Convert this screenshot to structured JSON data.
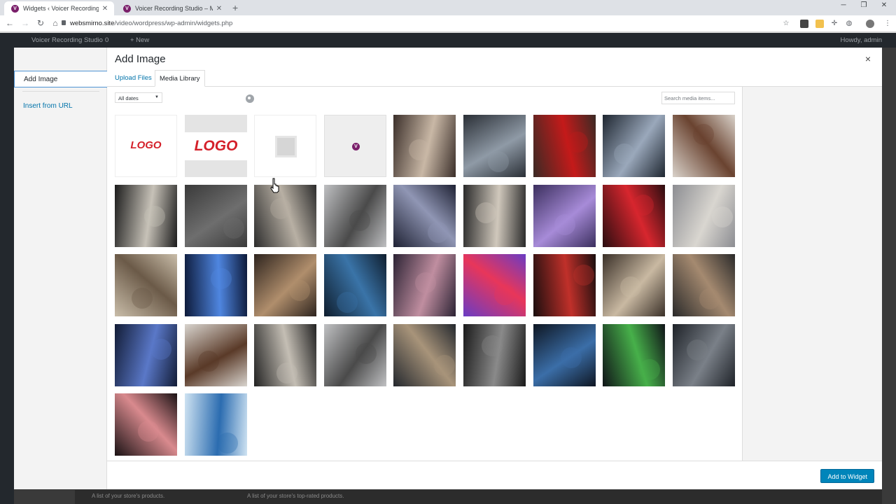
{
  "browser": {
    "tabs": [
      {
        "title": "Widgets ‹ Voicer Recording Studio",
        "active": true
      },
      {
        "title": "Voicer Recording Studio – Music",
        "active": false
      }
    ],
    "url_host": "websmirno.site",
    "url_path": "/video/wordpress/wp-admin/widgets.php"
  },
  "admin_bar": {
    "site_name": "Voicer Recording Studio",
    "comments_count": "0",
    "new_label": "+ New",
    "howdy": "Howdy, admin"
  },
  "footer": {
    "text_left": "A list of your store's products.",
    "text_right": "A list of your store's top-rated products."
  },
  "modal": {
    "title": "Add Image",
    "close_icon": "×",
    "menu": {
      "add_image": "Add Image",
      "insert_from_url": "Insert from URL"
    },
    "tabs": {
      "upload": "Upload Files",
      "library": "Media Library"
    },
    "filter_selected": "All dates",
    "search_placeholder": "Search media items...",
    "submit_label": "Add to Widget"
  },
  "media_items": [
    {
      "name": "media-logo-white",
      "kind": "logo-white",
      "label": "LOGO"
    },
    {
      "name": "media-logo-band",
      "kind": "logo-band",
      "label": "LOGO"
    },
    {
      "name": "media-placeholder",
      "kind": "placeholder"
    },
    {
      "name": "media-favicon",
      "kind": "favicon",
      "label": "V"
    },
    {
      "name": "media-room-interior",
      "kind": "photo",
      "colors": [
        "#3b2f2a",
        "#c9b8a6"
      ]
    },
    {
      "name": "media-studio-desk",
      "kind": "photo",
      "colors": [
        "#2a2f36",
        "#8f9aa6"
      ]
    },
    {
      "name": "media-red-chair",
      "kind": "photo",
      "colors": [
        "#3a2a24",
        "#c41a1a"
      ]
    },
    {
      "name": "media-mixing-console",
      "kind": "photo",
      "colors": [
        "#1e2630",
        "#9aa8bb"
      ]
    },
    {
      "name": "media-woman-headphones",
      "kind": "photo",
      "colors": [
        "#d9d2ca",
        "#6a4330"
      ]
    },
    {
      "name": "media-microphone-1",
      "kind": "photo",
      "colors": [
        "#1c1c1c",
        "#c7c2b8"
      ]
    },
    {
      "name": "media-audio-waveform",
      "kind": "photo",
      "colors": [
        "#3a3a3a",
        "#6e6e6e"
      ]
    },
    {
      "name": "media-headphones-console",
      "kind": "photo",
      "colors": [
        "#2c2c2c",
        "#b8b0a4"
      ]
    },
    {
      "name": "media-man-podcast",
      "kind": "photo",
      "colors": [
        "#bfc0c2",
        "#4a4a4a"
      ]
    },
    {
      "name": "media-headphones-dark",
      "kind": "photo",
      "colors": [
        "#1f2234",
        "#9096b4"
      ]
    },
    {
      "name": "media-microphone-2",
      "kind": "photo",
      "colors": [
        "#2a2a2a",
        "#d0c8bc"
      ]
    },
    {
      "name": "media-woman-singing",
      "kind": "photo",
      "colors": [
        "#3b2f5e",
        "#a78bd8"
      ]
    },
    {
      "name": "media-singer-red",
      "kind": "photo",
      "colors": [
        "#2a0d10",
        "#d7262e"
      ]
    },
    {
      "name": "media-headphones-light",
      "kind": "photo",
      "colors": [
        "#8c8d92",
        "#d9d6d0"
      ]
    },
    {
      "name": "media-woman-mic",
      "kind": "photo",
      "colors": [
        "#c9bda9",
        "#6b5a48"
      ]
    },
    {
      "name": "media-blue-mixer",
      "kind": "photo",
      "colors": [
        "#0d1a3a",
        "#4f86e0"
      ]
    },
    {
      "name": "media-band-session",
      "kind": "photo",
      "colors": [
        "#2e241e",
        "#b08e6c"
      ]
    },
    {
      "name": "media-guitar",
      "kind": "photo",
      "colors": [
        "#0f1e2e",
        "#3a74a8"
      ]
    },
    {
      "name": "media-headphones-pink",
      "kind": "photo",
      "colors": [
        "#2c2334",
        "#c08ea0"
      ]
    },
    {
      "name": "media-neon-woman",
      "kind": "photo",
      "colors": [
        "#6a3cc4",
        "#e8365a"
      ]
    },
    {
      "name": "media-red-studio",
      "kind": "photo",
      "colors": [
        "#1a0e0e",
        "#c0302a"
      ]
    },
    {
      "name": "media-engineer",
      "kind": "photo",
      "colors": [
        "#3a3028",
        "#c9b9a2"
      ]
    },
    {
      "name": "media-two-singers",
      "kind": "photo",
      "colors": [
        "#2a2a2a",
        "#a58a70"
      ]
    },
    {
      "name": "media-keyboard-hands",
      "kind": "photo",
      "colors": [
        "#121c36",
        "#5a78c8"
      ]
    },
    {
      "name": "media-curly-woman",
      "kind": "photo",
      "colors": [
        "#d8d4ce",
        "#5a3a28"
      ]
    },
    {
      "name": "media-microphone-3",
      "kind": "photo",
      "colors": [
        "#222222",
        "#c4beb4"
      ]
    },
    {
      "name": "media-man-podcast-2",
      "kind": "photo",
      "colors": [
        "#c0c1c3",
        "#4a4a4a"
      ]
    },
    {
      "name": "media-drum-room",
      "kind": "photo",
      "colors": [
        "#24282e",
        "#a8947a"
      ]
    },
    {
      "name": "media-cables",
      "kind": "photo",
      "colors": [
        "#1a1a1a",
        "#8a8a8a"
      ]
    },
    {
      "name": "media-control-room",
      "kind": "photo",
      "colors": [
        "#0e1622",
        "#3b6ea8"
      ]
    },
    {
      "name": "media-rack-meters",
      "kind": "photo",
      "colors": [
        "#101418",
        "#47b04a"
      ]
    },
    {
      "name": "media-vintage-mic",
      "kind": "photo",
      "colors": [
        "#1e2228",
        "#7a8088"
      ]
    },
    {
      "name": "media-singer-close",
      "kind": "photo",
      "colors": [
        "#1a1214",
        "#d98a8e"
      ]
    },
    {
      "name": "media-blue-abstract",
      "kind": "photo",
      "colors": [
        "#cfe3f2",
        "#2b6cb0"
      ]
    }
  ]
}
